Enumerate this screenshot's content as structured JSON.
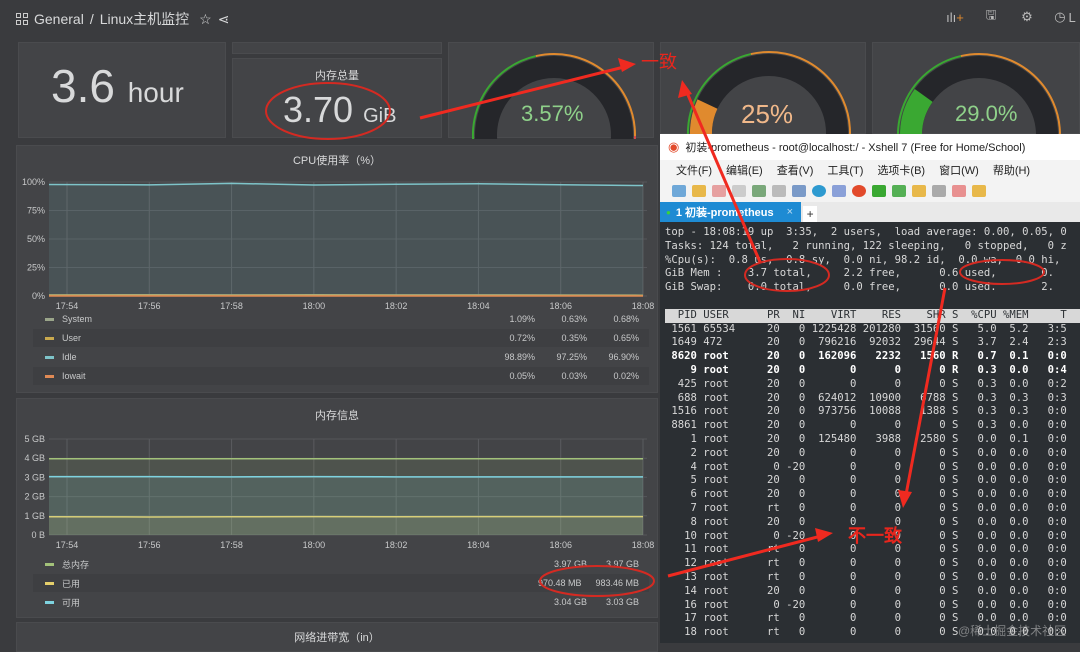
{
  "header": {
    "breadcrumb_folder": "General",
    "breadcrumb_sep": "/",
    "breadcrumb_dashboard": "Linux主机监控",
    "time_picker_label": "L"
  },
  "stats": {
    "uptime": {
      "value": "3.6",
      "unit": "hour"
    },
    "memory_total": {
      "title": "内存总量",
      "value": "3.70",
      "unit": "GiB"
    }
  },
  "gauges": [
    {
      "value": "3.57%",
      "fraction": 0.0357,
      "color": "#3aa832",
      "text_color": "#8fd18a"
    },
    {
      "value": "25%",
      "fraction": 0.25,
      "color": "#e08a2e",
      "text_color": "#f0b88a"
    },
    {
      "value": "29.0%",
      "fraction": 0.29,
      "color": "#3aa832",
      "text_color": "#8fd18a"
    }
  ],
  "annotations": {
    "consistent": "一致",
    "inconsistent": "不一致",
    "watermark": "@稀土掘金技术社区"
  },
  "chart_data": [
    {
      "type": "area",
      "title": "CPU使用率（%）",
      "x": [
        "17:54",
        "17:56",
        "17:58",
        "18:00",
        "18:02",
        "18:04",
        "18:06",
        "18:08"
      ],
      "yticks": [
        "100%",
        "75%",
        "50%",
        "25%",
        "0%"
      ],
      "ylim": [
        0,
        100
      ],
      "series": [
        {
          "name": "System",
          "color": "#9aa58a",
          "values": [
            1.0,
            1.1,
            1.0,
            1.1,
            1.0,
            1.0,
            0.9,
            0.7
          ],
          "legend": [
            "1.09%",
            "0.63%",
            "0.68%"
          ]
        },
        {
          "name": "User",
          "color": "#c9a94e",
          "values": [
            0.7,
            0.7,
            0.6,
            0.7,
            0.6,
            0.6,
            0.5,
            0.6
          ],
          "legend": [
            "0.72%",
            "0.35%",
            "0.65%"
          ]
        },
        {
          "name": "Idle",
          "color": "#7ec4c9",
          "values": [
            97.8,
            97.5,
            98.8,
            97.4,
            98.0,
            98.5,
            97.6,
            96.9
          ],
          "legend": [
            "98.89%",
            "97.25%",
            "96.90%"
          ]
        },
        {
          "name": "Iowait",
          "color": "#e08a55",
          "values": [
            0.05,
            0.04,
            0.05,
            0.03,
            0.04,
            0.03,
            0.03,
            0.02
          ],
          "legend": [
            "0.05%",
            "0.03%",
            "0.02%"
          ]
        }
      ]
    },
    {
      "type": "area",
      "title": "内存信息",
      "x": [
        "17:54",
        "17:56",
        "17:58",
        "18:00",
        "18:02",
        "18:04",
        "18:06",
        "18:08"
      ],
      "yticks": [
        "5 GB",
        "4 GB",
        "3 GB",
        "2 GB",
        "1 GB",
        "0 B"
      ],
      "ylim": [
        0,
        5
      ],
      "series": [
        {
          "name": "总内存",
          "color": "#a3c27a",
          "values": [
            3.97,
            3.97,
            3.97,
            3.97,
            3.97,
            3.97,
            3.97,
            3.97
          ],
          "legend": [
            "3.97 GB",
            "3.97 GB"
          ]
        },
        {
          "name": "已用",
          "color": "#e5cf6b",
          "values": [
            0.95,
            0.94,
            0.95,
            0.96,
            0.95,
            0.96,
            0.96,
            0.96
          ],
          "legend": [
            "970.48 MB",
            "983.46 MB"
          ]
        },
        {
          "name": "可用",
          "color": "#7ed3e0",
          "values": [
            3.04,
            3.04,
            3.03,
            3.04,
            3.03,
            3.03,
            3.03,
            3.03
          ],
          "legend": [
            "3.04 GB",
            "3.03 GB"
          ]
        }
      ]
    }
  ],
  "next_panel_title": "网络进带宽（in）",
  "xshell": {
    "title": "初装-prometheus - root@localhost:/ - Xshell 7 (Free for Home/School)",
    "menu": [
      "文件(F)",
      "编辑(E)",
      "查看(V)",
      "工具(T)",
      "选项卡(B)",
      "窗口(W)",
      "帮助(H)"
    ],
    "tab_label": "1 初装-prometheus",
    "tab_close": "×",
    "tab_add": "+",
    "top_summary": [
      "top - 18:08:19 up  3:35,  2 users,  load average: 0.00, 0.05, 0",
      "Tasks: 124 total,   2 running, 122 sleeping,   0 stopped,   0 z",
      "%Cpu(s):  0.8 us,  0.8 sy,  0.0 ni, 98.2 id,  0.0 wa,  0.0 hi,",
      "GiB Mem :    3.7 total,     2.2 free,      0.6 used,       0.",
      "GiB Swap:    0.0 total,     0.0 free,      0.0 used.       2."
    ],
    "process_header": "  PID USER      PR  NI    VIRT    RES    SHR S  %CPU %MEM     T",
    "processes": [
      {
        "line": " 1561 65534     20   0 1225428 201280  31560 S   5.0  5.2   3:5",
        "bold": false
      },
      {
        "line": " 1649 472       20   0  796216  92032  29644 S   3.7  2.4   2:3",
        "bold": false
      },
      {
        "line": " 8620 root      20   0  162096   2232   1560 R   0.7  0.1   0:0",
        "bold": true
      },
      {
        "line": "    9 root      20   0       0      0      0 R   0.3  0.0   0:4",
        "bold": true
      },
      {
        "line": "  425 root      20   0       0      0      0 S   0.3  0.0   0:2",
        "bold": false
      },
      {
        "line": "  688 root      20   0  624012  10900   6788 S   0.3  0.3   0:3",
        "bold": false
      },
      {
        "line": " 1516 root      20   0  973756  10088   1388 S   0.3  0.3   0:0",
        "bold": false
      },
      {
        "line": " 8861 root      20   0       0      0      0 S   0.3  0.0   0:0",
        "bold": false
      },
      {
        "line": "    1 root      20   0  125480   3988   2580 S   0.0  0.1   0:0",
        "bold": false
      },
      {
        "line": "    2 root      20   0       0      0      0 S   0.0  0.0   0:0",
        "bold": false
      },
      {
        "line": "    4 root       0 -20       0      0      0 S   0.0  0.0   0:0",
        "bold": false
      },
      {
        "line": "    5 root      20   0       0      0      0 S   0.0  0.0   0:0",
        "bold": false
      },
      {
        "line": "    6 root      20   0       0      0      0 S   0.0  0.0   0:0",
        "bold": false
      },
      {
        "line": "    7 root      rt   0       0      0      0 S   0.0  0.0   0:0",
        "bold": false
      },
      {
        "line": "    8 root      20   0       0      0      0 S   0.0  0.0   0:0",
        "bold": false
      },
      {
        "line": "   10 root       0 -20       0      0      0 S   0.0  0.0   0:0",
        "bold": false
      },
      {
        "line": "   11 root      rt   0       0      0      0 S   0.0  0.0   0:0",
        "bold": false
      },
      {
        "line": "   12 root      rt   0       0      0      0 S   0.0  0.0   0:0",
        "bold": false
      },
      {
        "line": "   13 root      rt   0       0      0      0 S   0.0  0.0   0:0",
        "bold": false
      },
      {
        "line": "   14 root      20   0       0      0      0 S   0.0  0.0   0:0",
        "bold": false
      },
      {
        "line": "   16 root       0 -20       0      0      0 S   0.0  0.0   0:0",
        "bold": false
      },
      {
        "line": "   17 root      rt   0       0      0      0 S   0.0  0.0   0:0",
        "bold": false
      },
      {
        "line": "   18 root      rt   0       0      0      0 S   0.0  0.0   0:0",
        "bold": false
      }
    ]
  }
}
